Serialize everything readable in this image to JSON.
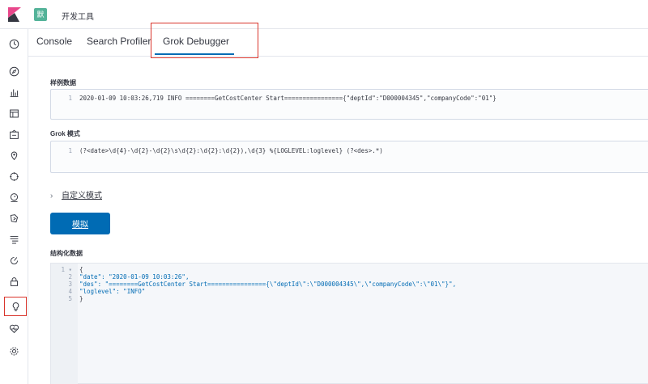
{
  "header": {
    "space_initial": "默",
    "title": "开发工具"
  },
  "sidebar": {
    "items": [
      {
        "icon": "clock-icon",
        "active": false
      },
      {
        "icon": "compass-icon",
        "active": false
      },
      {
        "icon": "bar-chart-icon",
        "active": false
      },
      {
        "icon": "dashboard-icon",
        "active": false
      },
      {
        "icon": "canvas-icon",
        "active": false
      },
      {
        "icon": "map-icon",
        "active": false
      },
      {
        "icon": "ml-icon",
        "active": false
      },
      {
        "icon": "metrics-icon",
        "active": false
      },
      {
        "icon": "apm-icon",
        "active": false
      },
      {
        "icon": "logs-icon",
        "active": false
      },
      {
        "icon": "uptime-icon",
        "active": false
      },
      {
        "icon": "siem-icon",
        "active": false
      },
      {
        "icon": "dev-tools-icon",
        "active": true
      },
      {
        "icon": "monitoring-icon",
        "active": false
      },
      {
        "icon": "gear-icon",
        "active": false
      }
    ]
  },
  "tabs": [
    {
      "label": "Console"
    },
    {
      "label": "Search Profiler"
    },
    {
      "label": "Grok Debugger"
    }
  ],
  "sample": {
    "label": "样例数据",
    "lines": [
      {
        "no": "1",
        "text": "2020-01-09 10:03:26,719 INFO ========GetCostCenter Start================{\"deptId\":\"D000004345\",\"companyCode\":\"01\"}"
      }
    ]
  },
  "grok": {
    "label": "Grok 模式",
    "lines": [
      {
        "no": "1",
        "text": "(?<date>\\d{4}-\\d{2}-\\d{2}\\s\\d{2}:\\d{2}:\\d{2}),\\d{3} %{LOGLEVEL:loglevel} (?<des>.*)"
      }
    ]
  },
  "custom_patterns": {
    "label": "自定义模式"
  },
  "simulate_button": {
    "label": "模拟"
  },
  "structured": {
    "label": "结构化数据",
    "lines": [
      {
        "no": "1 ▾",
        "text": "{"
      },
      {
        "no": "2",
        "text": "  \"date\": \"2020-01-09 10:03:26\","
      },
      {
        "no": "3",
        "text": "  \"des\": \"========GetCostCenter Start================{\\\"deptId\\\":\\\"D000004345\\\",\\\"companyCode\\\":\\\"01\\\"}\","
      },
      {
        "no": "4",
        "text": "  \"loglevel\": \"INFO\""
      },
      {
        "no": "5",
        "text": "}"
      }
    ]
  },
  "colors": {
    "accent": "#006bb4",
    "highlight_box": "#d9342b",
    "space_badge": "#54b399"
  }
}
